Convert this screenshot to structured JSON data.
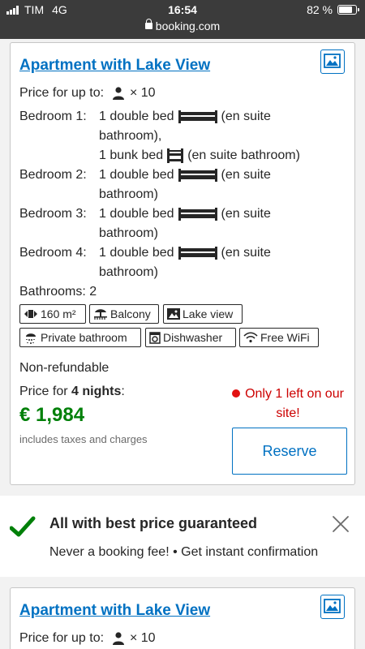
{
  "status_bar": {
    "carrier": "TIM",
    "network": "4G",
    "time": "16:54",
    "battery": "82 %",
    "battery_level": 0.82,
    "url": "booking.com"
  },
  "rooms": [
    {
      "title": "Apartment with Lake View",
      "price_for_label": "Price for up to:",
      "guests": "× 10",
      "beds": [
        {
          "label": "Bedroom 1:",
          "lines": [
            "1 double bed",
            "(en suite",
            "bathroom),",
            "1 bunk bed",
            "(en suite bathroom)"
          ]
        },
        {
          "label": "Bedroom 2:",
          "lines": [
            "1 double bed",
            "(en suite",
            "bathroom)"
          ]
        },
        {
          "label": "Bedroom 3:",
          "lines": [
            "1 double bed",
            "(en suite",
            "bathroom)"
          ]
        },
        {
          "label": "Bedroom 4:",
          "lines": [
            "1 double bed",
            "(en suite",
            "bathroom)"
          ]
        }
      ],
      "bathrooms": "Bathrooms: 2",
      "facilities": [
        "160 m²",
        "Balcony",
        "Lake view",
        "Private bathroom",
        "Dishwasher",
        "Free WiFi"
      ],
      "policy": "Non-refundable",
      "price_label": "Price for",
      "nights": "4 nights",
      "price_label_suffix": ":",
      "price": "€ 1,984",
      "taxes": "includes taxes and charges",
      "availability": "Only 1 left on our site!",
      "reserve": "Reserve"
    },
    {
      "title": "Apartment with Lake View",
      "price_for_label": "Price for up to:",
      "guests": "× 10"
    }
  ],
  "banner": {
    "title": "All with best price guaranteed",
    "subtitle": "Never a booking fee! • Get instant confirmation"
  },
  "colors": {
    "link_blue": "#0071c2",
    "price_green": "#008009",
    "alert_red": "#cc0000",
    "check_green": "#008009"
  },
  "icons": [
    "person-icon",
    "double-bed-icon",
    "bunk-bed-icon",
    "photo-icon",
    "area-icon",
    "balcony-icon",
    "lake-view-icon",
    "shower-icon",
    "dishwasher-icon",
    "wifi-icon",
    "checkmark-icon",
    "close-icon",
    "lock-icon"
  ]
}
